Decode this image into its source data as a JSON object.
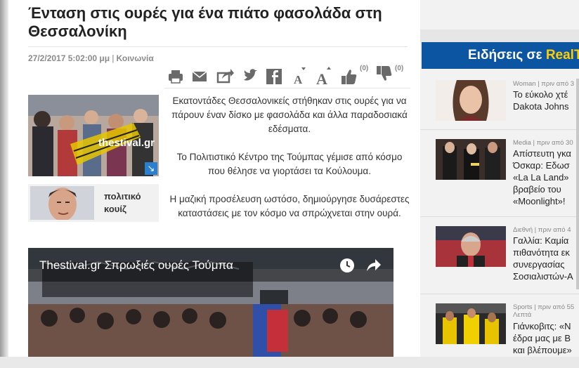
{
  "article": {
    "title": "Ένταση στις ουρές για ένα πιάτο φασολάδα στη Θεσσαλονίκη",
    "date": "27/2/2017 5:02:00 μμ",
    "separator": "|",
    "category": "Κοινωνία",
    "paragraphs": [
      "Εκατοντάδες Θεσσαλονικείς στήθηκαν στις ουρές για να πάρουν έναν δίσκο με φασολάδα και άλλα παραδοσιακά εδέσματα.",
      "Το Πολιτιστικό Κέντρο της Τούμπας γέμισε από κόσμο που θέλησε να γιορτάσει τα Κούλουμα.",
      "Η μαζική προσέλευση ωστόσο, δημιούργησε δυσάρεστες καταστάσεις με τον κόσμο να σπρώχνεται στην ουρά."
    ],
    "image_logo": "thestival.gr",
    "quiz_label": "πολιτικό κουίζ"
  },
  "toolbar": {
    "icons": [
      "print-icon",
      "email-icon",
      "share-icon",
      "twitter-icon",
      "facebook-icon",
      "font-decrease-icon",
      "font-increase-icon",
      "thumbs-up-icon",
      "thumbs-down-icon"
    ],
    "like_count": "(0)",
    "dislike_count": "(0)"
  },
  "video": {
    "title": "Thestival.gr Σπρωξιές ουρές Τούμπα"
  },
  "sidebar": {
    "header_part1": "Ειδήσεις σε ",
    "header_part2": "RealT",
    "items": [
      {
        "category": "Woman",
        "time": "| πριν από 3",
        "title_lines": [
          "Το εύκολο χτέ",
          "Dakota Johns"
        ]
      },
      {
        "category": "Media",
        "time": "| πριν από 30",
        "title_lines": [
          "Απίστευτη γκα",
          "Όσκαρ: Εδωσ",
          "«La La Land»",
          "βραβείο του",
          "«Moonlight»!"
        ]
      },
      {
        "category": "Διεθνή",
        "time": "| πριν από 4",
        "title_lines": [
          "Γαλλία: Καμία",
          "πιθανότητα εκ",
          "συνεργασίας",
          "Σοσιαλιστών-Α"
        ]
      },
      {
        "category": "Sports",
        "time": "| πριν από 55",
        "time2": "Λεπτά",
        "title_lines": [
          "Γιάνκοβιτς: «Ν",
          "έδρα μας με Β",
          "και βλέπουμε»"
        ]
      }
    ]
  },
  "colors": {
    "accent": "#0b55a3",
    "highlight": "#ffce00",
    "icon": "#6a6a6a"
  }
}
